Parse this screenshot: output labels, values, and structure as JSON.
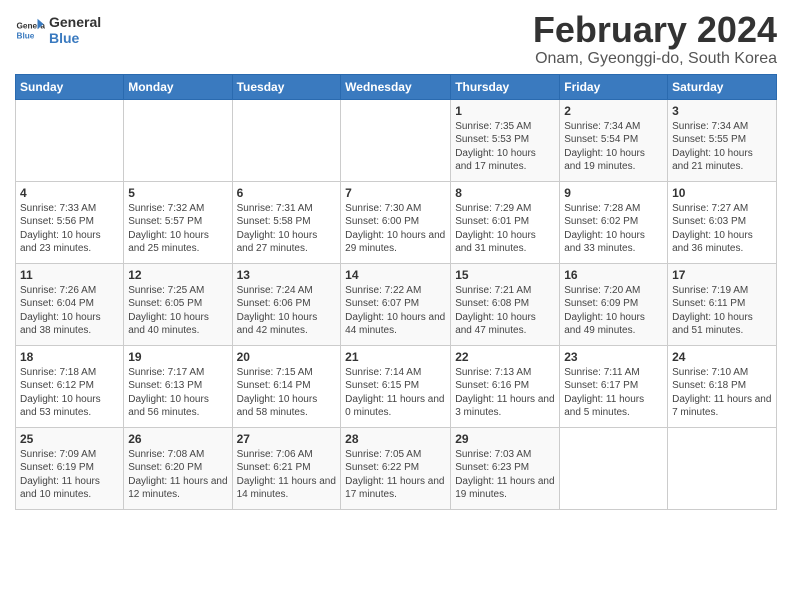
{
  "header": {
    "logo_line1": "General",
    "logo_line2": "Blue",
    "month_year": "February 2024",
    "location": "Onam, Gyeonggi-do, South Korea"
  },
  "weekdays": [
    "Sunday",
    "Monday",
    "Tuesday",
    "Wednesday",
    "Thursday",
    "Friday",
    "Saturday"
  ],
  "weeks": [
    [
      {
        "day": "",
        "info": ""
      },
      {
        "day": "",
        "info": ""
      },
      {
        "day": "",
        "info": ""
      },
      {
        "day": "",
        "info": ""
      },
      {
        "day": "1",
        "info": "Sunrise: 7:35 AM\nSunset: 5:53 PM\nDaylight: 10 hours\nand 17 minutes."
      },
      {
        "day": "2",
        "info": "Sunrise: 7:34 AM\nSunset: 5:54 PM\nDaylight: 10 hours\nand 19 minutes."
      },
      {
        "day": "3",
        "info": "Sunrise: 7:34 AM\nSunset: 5:55 PM\nDaylight: 10 hours\nand 21 minutes."
      }
    ],
    [
      {
        "day": "4",
        "info": "Sunrise: 7:33 AM\nSunset: 5:56 PM\nDaylight: 10 hours\nand 23 minutes."
      },
      {
        "day": "5",
        "info": "Sunrise: 7:32 AM\nSunset: 5:57 PM\nDaylight: 10 hours\nand 25 minutes."
      },
      {
        "day": "6",
        "info": "Sunrise: 7:31 AM\nSunset: 5:58 PM\nDaylight: 10 hours\nand 27 minutes."
      },
      {
        "day": "7",
        "info": "Sunrise: 7:30 AM\nSunset: 6:00 PM\nDaylight: 10 hours\nand 29 minutes."
      },
      {
        "day": "8",
        "info": "Sunrise: 7:29 AM\nSunset: 6:01 PM\nDaylight: 10 hours\nand 31 minutes."
      },
      {
        "day": "9",
        "info": "Sunrise: 7:28 AM\nSunset: 6:02 PM\nDaylight: 10 hours\nand 33 minutes."
      },
      {
        "day": "10",
        "info": "Sunrise: 7:27 AM\nSunset: 6:03 PM\nDaylight: 10 hours\nand 36 minutes."
      }
    ],
    [
      {
        "day": "11",
        "info": "Sunrise: 7:26 AM\nSunset: 6:04 PM\nDaylight: 10 hours\nand 38 minutes."
      },
      {
        "day": "12",
        "info": "Sunrise: 7:25 AM\nSunset: 6:05 PM\nDaylight: 10 hours\nand 40 minutes."
      },
      {
        "day": "13",
        "info": "Sunrise: 7:24 AM\nSunset: 6:06 PM\nDaylight: 10 hours\nand 42 minutes."
      },
      {
        "day": "14",
        "info": "Sunrise: 7:22 AM\nSunset: 6:07 PM\nDaylight: 10 hours\nand 44 minutes."
      },
      {
        "day": "15",
        "info": "Sunrise: 7:21 AM\nSunset: 6:08 PM\nDaylight: 10 hours\nand 47 minutes."
      },
      {
        "day": "16",
        "info": "Sunrise: 7:20 AM\nSunset: 6:09 PM\nDaylight: 10 hours\nand 49 minutes."
      },
      {
        "day": "17",
        "info": "Sunrise: 7:19 AM\nSunset: 6:11 PM\nDaylight: 10 hours\nand 51 minutes."
      }
    ],
    [
      {
        "day": "18",
        "info": "Sunrise: 7:18 AM\nSunset: 6:12 PM\nDaylight: 10 hours\nand 53 minutes."
      },
      {
        "day": "19",
        "info": "Sunrise: 7:17 AM\nSunset: 6:13 PM\nDaylight: 10 hours\nand 56 minutes."
      },
      {
        "day": "20",
        "info": "Sunrise: 7:15 AM\nSunset: 6:14 PM\nDaylight: 10 hours\nand 58 minutes."
      },
      {
        "day": "21",
        "info": "Sunrise: 7:14 AM\nSunset: 6:15 PM\nDaylight: 11 hours\nand 0 minutes."
      },
      {
        "day": "22",
        "info": "Sunrise: 7:13 AM\nSunset: 6:16 PM\nDaylight: 11 hours\nand 3 minutes."
      },
      {
        "day": "23",
        "info": "Sunrise: 7:11 AM\nSunset: 6:17 PM\nDaylight: 11 hours\nand 5 minutes."
      },
      {
        "day": "24",
        "info": "Sunrise: 7:10 AM\nSunset: 6:18 PM\nDaylight: 11 hours\nand 7 minutes."
      }
    ],
    [
      {
        "day": "25",
        "info": "Sunrise: 7:09 AM\nSunset: 6:19 PM\nDaylight: 11 hours\nand 10 minutes."
      },
      {
        "day": "26",
        "info": "Sunrise: 7:08 AM\nSunset: 6:20 PM\nDaylight: 11 hours\nand 12 minutes."
      },
      {
        "day": "27",
        "info": "Sunrise: 7:06 AM\nSunset: 6:21 PM\nDaylight: 11 hours\nand 14 minutes."
      },
      {
        "day": "28",
        "info": "Sunrise: 7:05 AM\nSunset: 6:22 PM\nDaylight: 11 hours\nand 17 minutes."
      },
      {
        "day": "29",
        "info": "Sunrise: 7:03 AM\nSunset: 6:23 PM\nDaylight: 11 hours\nand 19 minutes."
      },
      {
        "day": "",
        "info": ""
      },
      {
        "day": "",
        "info": ""
      }
    ]
  ]
}
